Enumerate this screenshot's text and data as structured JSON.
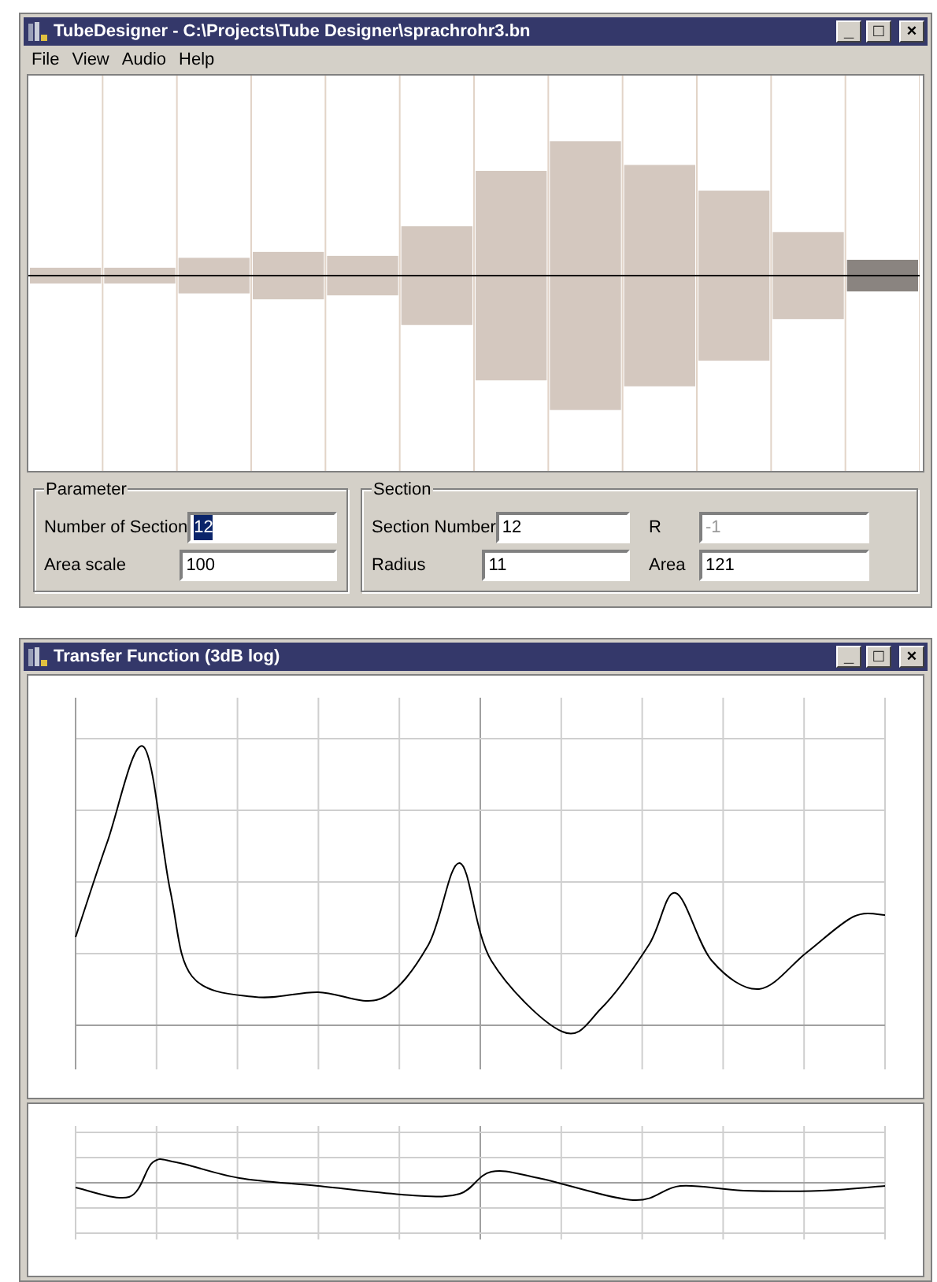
{
  "main_window": {
    "title": "TubeDesigner - C:\\Projects\\Tube Designer\\sprachrohr3.bn",
    "controls": [
      "_",
      "□",
      "×"
    ]
  },
  "menu": [
    "File",
    "View",
    "Audio",
    "Help"
  ],
  "tube": {
    "sections": [
      {
        "selected": false
      },
      {
        "selected": false
      },
      {
        "selected": false
      },
      {
        "selected": false
      },
      {
        "selected": false
      },
      {
        "selected": false
      },
      {
        "selected": false
      },
      {
        "selected": false
      },
      {
        "selected": false
      },
      {
        "selected": false
      },
      {
        "selected": false
      },
      {
        "selected": true
      }
    ]
  },
  "parameter": {
    "title": "Parameter",
    "fields": [
      {
        "label": "Number of Section",
        "value": "12",
        "selected": true,
        "disabled": false
      },
      {
        "label": "Area scale",
        "value": "100",
        "selected": false,
        "disabled": false
      }
    ]
  },
  "section": {
    "title": "Section",
    "fields": [
      {
        "label": "Section Number",
        "value": "12",
        "selected": false,
        "disabled": false
      },
      {
        "label": "R",
        "value": "-1",
        "selected": false,
        "disabled": true
      },
      {
        "label": "Radius",
        "value": "11",
        "selected": false,
        "disabled": false
      },
      {
        "label": "Area",
        "value": "121",
        "selected": false,
        "disabled": false
      }
    ]
  },
  "transfer_window": {
    "title": "Transfer Function (3dB log)",
    "controls": [
      "_",
      "□",
      "×"
    ]
  }
}
